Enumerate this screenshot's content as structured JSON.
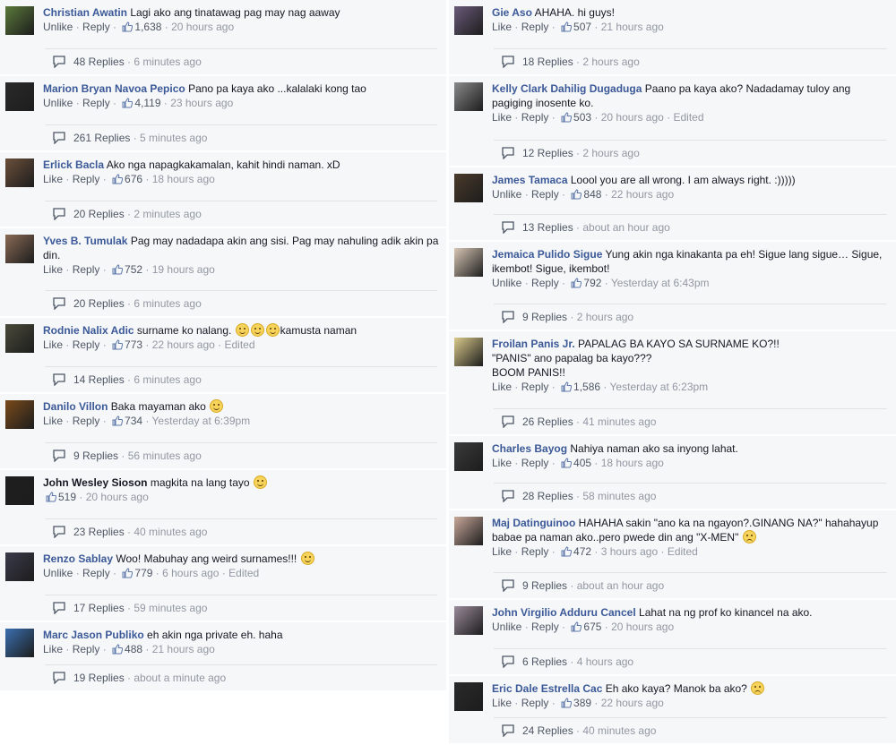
{
  "left": [
    {
      "name": "Christian Awatin",
      "text": "Lagi ako ang tinatawag pag may nag aaway",
      "action": "Unlike",
      "reply": "Reply",
      "likes": "1,638",
      "time": "20 hours ago",
      "edited": "",
      "replies": "48 Replies",
      "reply_time": "6 minutes ago",
      "avatar": "#5a7a3a"
    },
    {
      "name": "Marion Bryan Navoa Pepico",
      "text": "Pano pa kaya ako ...kalalaki kong tao",
      "action": "Unlike",
      "reply": "Reply",
      "likes": "4,119",
      "time": "23 hours ago",
      "edited": "",
      "replies": "261 Replies",
      "reply_time": "5 minutes ago",
      "avatar": "#2a2a2a"
    },
    {
      "name": "Erlick Bacla",
      "text": "Ako nga napagkakamalan, kahit hindi naman. xD",
      "action": "Like",
      "reply": "Reply",
      "likes": "676",
      "time": "18 hours ago",
      "edited": "",
      "replies": "20 Replies",
      "reply_time": "2 minutes ago",
      "avatar": "#6b4f3a"
    },
    {
      "name": "Yves B. Tumulak",
      "text": "Pag may nadadapa akin ang sisi. Pag may nahuling adik akin pa din.",
      "action": "Like",
      "reply": "Reply",
      "likes": "752",
      "time": "19 hours ago",
      "edited": "",
      "replies": "20 Replies",
      "reply_time": "6 minutes ago",
      "avatar": "#8a6a55"
    },
    {
      "name": "Rodnie Nalix Adic",
      "text": "surname ko nalang.",
      "text2": "kamusta naman",
      "action": "Like",
      "reply": "Reply",
      "likes": "773",
      "time": "22 hours ago",
      "edited": "Edited",
      "replies": "14 Replies",
      "reply_time": "6 minutes ago",
      "avatar": "#4a4a3a"
    },
    {
      "name": "Danilo Villon",
      "text": "Baka mayaman ako",
      "action": "Like",
      "reply": "Reply",
      "likes": "734",
      "time": "Yesterday at 6:39pm",
      "edited": "",
      "replies": "9 Replies",
      "reply_time": "56 minutes ago",
      "avatar": "#7a4a1a"
    },
    {
      "name": "John Wesley Sioson",
      "text": "magkita na lang tayo",
      "action": "",
      "reply": "",
      "likes": "519",
      "time": "20 hours ago",
      "edited": "",
      "replies": "23 Replies",
      "reply_time": "40 minutes ago",
      "avatar": "#1e1e1e"
    },
    {
      "name": "Renzo Sablay",
      "text": "Woo! Mabuhay ang weird surnames!!!",
      "action": "Unlike",
      "reply": "Reply",
      "likes": "779",
      "time": "6 hours ago",
      "edited": "Edited",
      "replies": "17 Replies",
      "reply_time": "59 minutes ago",
      "avatar": "#3a3a4a"
    },
    {
      "name": "Marc Jason Publiko",
      "text": "eh akin nga private eh. haha",
      "action": "Like",
      "reply": "Reply",
      "likes": "488",
      "time": "21 hours ago",
      "edited": "",
      "replies": "19 Replies",
      "reply_time": "about a minute ago",
      "avatar": "#3a6fb0"
    }
  ],
  "right": [
    {
      "name": "Gie Aso",
      "text": "AHAHA. hi guys!",
      "action": "Like",
      "reply": "Reply",
      "likes": "507",
      "time": "21 hours ago",
      "edited": "",
      "replies": "18 Replies",
      "reply_time": "2 hours ago",
      "avatar": "#6a5a7a"
    },
    {
      "name": "Kelly Clark Dahilig Dugaduga",
      "text": "Paano pa kaya ako? Nadadamay tuloy ang pagiging inosente ko.",
      "action": "Like",
      "reply": "Reply",
      "likes": "503",
      "time": "20 hours ago",
      "edited": "Edited",
      "replies": "12 Replies",
      "reply_time": "2 hours ago",
      "avatar": "#8a8a8a"
    },
    {
      "name": "James Tamaca",
      "text": "Loool you are all wrong. I am always right. :)))))",
      "action": "Unlike",
      "reply": "Reply",
      "likes": "848",
      "time": "22 hours ago",
      "edited": "",
      "replies": "13 Replies",
      "reply_time": "about an hour ago",
      "avatar": "#4a3a2a"
    },
    {
      "name": "Jemaica Pulido Sigue",
      "text": "Yung akin nga kinakanta pa eh! Sigue lang sigue… Sigue, ikembot! Sigue, ikembot!",
      "action": "Unlike",
      "reply": "Reply",
      "likes": "792",
      "time": "Yesterday at 6:43pm",
      "edited": "",
      "replies": "9 Replies",
      "reply_time": "2 hours ago",
      "avatar": "#d8c7b5"
    },
    {
      "name": "Froilan Panis Jr.",
      "text": "PAPALAG BA KAYO SA SURNAME KO?!!",
      "line2": "\"PANIS\" ano papalag ba kayo???",
      "line3": "BOOM PANIS!!",
      "action": "Like",
      "reply": "Reply",
      "likes": "1,586",
      "time": "Yesterday at 6:23pm",
      "edited": "",
      "replies": "26 Replies",
      "reply_time": "41 minutes ago",
      "avatar": "#d9c98a"
    },
    {
      "name": "Charles Bayog",
      "text": "Nahiya naman ako sa inyong lahat.",
      "action": "Like",
      "reply": "Reply",
      "likes": "405",
      "time": "18 hours ago",
      "edited": "",
      "replies": "28 Replies",
      "reply_time": "58 minutes ago",
      "avatar": "#3a3a3a"
    },
    {
      "name": "Maj Datinguinoo",
      "text": "HAHAHA sakin \"ano ka na ngayon?.GINANG NA?\" hahahayup babae pa naman ako..pero pwede din ang \"X-MEN\"",
      "action": "Like",
      "reply": "Reply",
      "likes": "472",
      "time": "3 hours ago",
      "edited": "Edited",
      "replies": "9 Replies",
      "reply_time": "about an hour ago",
      "avatar": "#c9a89a"
    },
    {
      "name": "John Virgilio Adduru Cancel",
      "text": "Lahat na ng prof ko kinancel na ako.",
      "action": "Unlike",
      "reply": "Reply",
      "likes": "675",
      "time": "20 hours ago",
      "edited": "",
      "replies": "6 Replies",
      "reply_time": "4 hours ago",
      "avatar": "#9a8a9a"
    },
    {
      "name": "Eric Dale Estrella Cac",
      "text": "Eh ako kaya? Manok ba ako?",
      "action": "Like",
      "reply": "Reply",
      "likes": "389",
      "time": "22 hours ago",
      "edited": "",
      "replies": "24 Replies",
      "reply_time": "40 minutes ago",
      "avatar": "#2a2a2a"
    }
  ]
}
